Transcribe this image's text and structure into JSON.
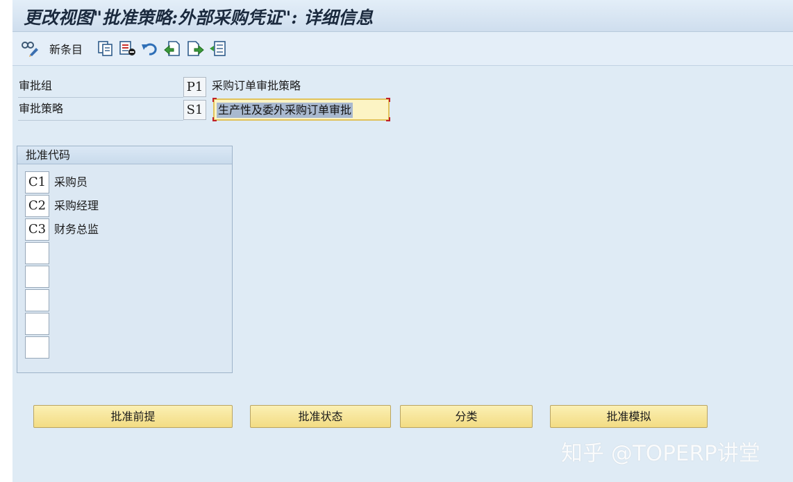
{
  "title": "更改视图\"批准策略:外部采购凭证\": 详细信息",
  "toolbar": {
    "new_entries_label": "新条目",
    "icons": [
      "display-change-icon",
      "copy-icon",
      "delete-icon",
      "undo-icon",
      "previous-entry-icon",
      "next-entry-icon",
      "select-all-icon"
    ]
  },
  "form": {
    "release_group": {
      "label": "审批组",
      "code": "P1",
      "description": "采购订单审批策略"
    },
    "release_strategy": {
      "label": "审批策略",
      "code": "S1",
      "description": "生产性及委外采购订单审批"
    }
  },
  "release_codes": {
    "header": "批准代码",
    "rows": [
      {
        "code": "C1",
        "text": "采购员"
      },
      {
        "code": "C2",
        "text": "采购经理"
      },
      {
        "code": "C3",
        "text": "财务总监"
      },
      {
        "code": "",
        "text": ""
      },
      {
        "code": "",
        "text": ""
      },
      {
        "code": "",
        "text": ""
      },
      {
        "code": "",
        "text": ""
      },
      {
        "code": "",
        "text": ""
      }
    ]
  },
  "buttons": {
    "prerequisites": "批准前提",
    "status": "批准状态",
    "classification": "分类",
    "simulation": "批准模拟"
  },
  "watermark": "知乎 @TOPERP讲堂",
  "colors": {
    "title_bar": "#dfebf5",
    "button_yellow": "#f7e49a",
    "input_yellow": "#fcf4c4",
    "selection": "#a9b9cf"
  }
}
